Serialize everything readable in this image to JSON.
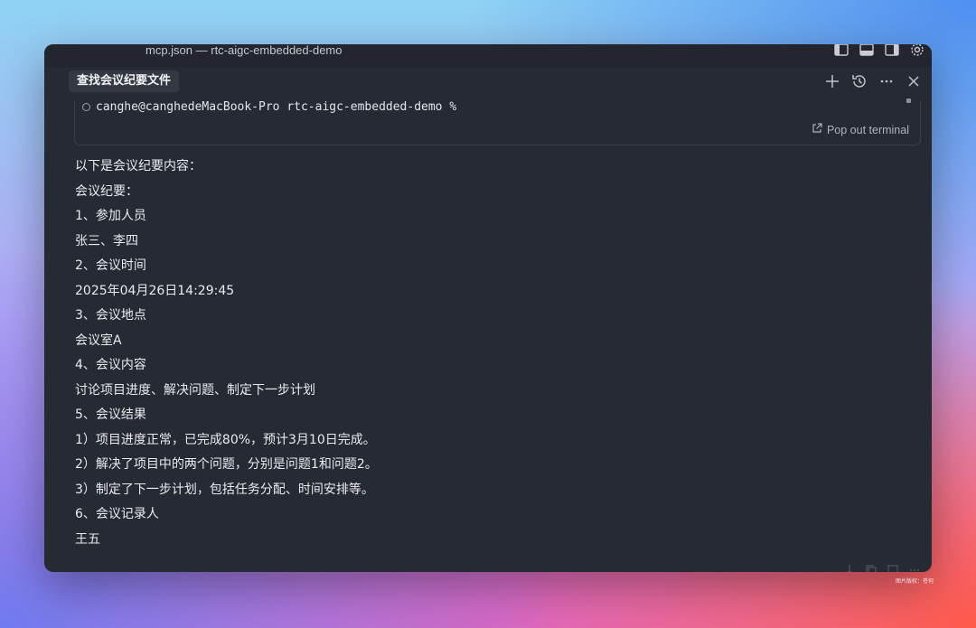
{
  "window": {
    "title": "mcp.json — rtc-aigc-embedded-demo"
  },
  "panel": {
    "chat_title": "查找会议纪要文件",
    "actions": [
      "plus-icon",
      "history-icon",
      "more-icon",
      "close-icon"
    ]
  },
  "terminal": {
    "prompt": "canghe@canghedeMacBook-Pro rtc-aigc-embedded-demo %",
    "popout_label": "Pop out terminal"
  },
  "response": {
    "lines": [
      "以下是会议纪要内容：",
      "会议纪要：",
      "1、参加人员",
      "张三、李四",
      "2、会议时间",
      "2025年04月26日14:29:45",
      "3、会议地点",
      "会议室A",
      "4、会议内容",
      "讨论项目进度、解决问题、制定下一步计划",
      "5、会议结果",
      "1）项目进度正常，已完成80%，预计3月10日完成。",
      "2）解决了项目中的两个问题，分别是问题1和问题2。",
      "3）制定了下一步计划，包括任务分配、时间安排等。",
      "6、会议记录人",
      "王五"
    ]
  },
  "watermark": "图片版权：苍何",
  "colors": {
    "window_bg": "#262a33",
    "text": "#e9ebee",
    "muted": "#aeb3bb"
  }
}
